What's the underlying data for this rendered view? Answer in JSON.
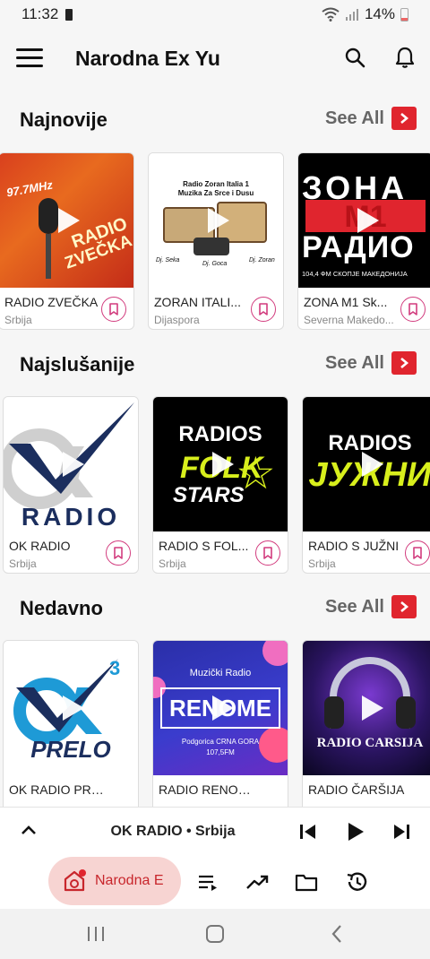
{
  "status": {
    "time": "11:32",
    "battery": "14%"
  },
  "app": {
    "title": "Narodna Ex Yu"
  },
  "sections": [
    {
      "title": "Najnovije",
      "see_all": "See All",
      "cards": [
        {
          "title": "RADIO ZVEČKA",
          "subtitle": "Srbija",
          "thumb_text_1": "97.7MHz",
          "thumb_text_2": "RADIO",
          "thumb_text_3": "ZVEČKA"
        },
        {
          "title": "ZORAN ITALI...",
          "subtitle": "Dijaspora",
          "thumb_text_1": "Radio Zoran Italia 1",
          "thumb_text_2": "Muzika Za Srce i Dusu",
          "thumb_text_3": "Dj. Seka",
          "thumb_text_4": "Dj. Goca",
          "thumb_text_5": "Dj. Zoran"
        },
        {
          "title": "ZONA M1 Sk...",
          "subtitle": "Severna Makedo...",
          "thumb_text_1": "ЗОНА",
          "thumb_text_2": "М1",
          "thumb_text_3": "РАДИО",
          "thumb_text_4": "104,4 ФМ СКОПЈЕ МАКЕДОНИЈА"
        }
      ]
    },
    {
      "title": "Najslušanije",
      "see_all": "See All",
      "cards": [
        {
          "title": "OK RADIO",
          "subtitle": "Srbija",
          "thumb_text_1": "RADIO"
        },
        {
          "title": "RADIO S FOL...",
          "subtitle": "Srbija",
          "thumb_text_1": "RADIOS",
          "thumb_text_2": "FOLK",
          "thumb_text_3": "STARS"
        },
        {
          "title": "RADIO S JUŽNI",
          "subtitle": "Srbija",
          "thumb_text_1": "RADIOS",
          "thumb_text_2": "ЈУЖНИ"
        }
      ]
    },
    {
      "title": "Nedavno",
      "see_all": "See All",
      "cards": [
        {
          "title": "OK RADIO PRELO",
          "subtitle": "",
          "thumb_text_1": "3",
          "thumb_text_2": "PRELO"
        },
        {
          "title": "RADIO RENOME",
          "subtitle": "",
          "thumb_text_1": "Muzički Radio",
          "thumb_text_2": "RENOME",
          "thumb_text_3": "Podgorica CRNA GORA",
          "thumb_text_4": "107,5FM"
        },
        {
          "title": "RADIO ČARŠIJA",
          "subtitle": "",
          "thumb_text_1": "RADIO CARSIJA"
        }
      ]
    }
  ],
  "player": {
    "now_playing": "OK RADIO • Srbija"
  },
  "bottom_nav": {
    "active_label": "Narodna E"
  },
  "colors": {
    "accent": "#e0252e",
    "bookmark": "#d23c7e",
    "pill": "#f7d4d2"
  }
}
